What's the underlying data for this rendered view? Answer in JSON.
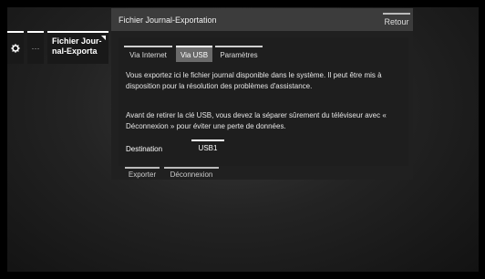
{
  "breadcrumb": {
    "gear_icon": "gear-icon",
    "more": "···",
    "current_line1": "Fichier Jour-",
    "current_line2": "nal-Exporta"
  },
  "dialog": {
    "title": "Fichier Journal-Exportation",
    "back_label": "Retour",
    "tabs": [
      {
        "label": "Via Internet",
        "selected": false
      },
      {
        "label": "Via USB",
        "selected": true
      },
      {
        "label": "Paramètres",
        "selected": false
      }
    ],
    "paragraph1": "Vous exportez ici le fichier journal disponible dans le système. Il peut être mis à disposition pour la résolution des problèmes d'assistance.",
    "paragraph2": "Avant de retirer la clé USB, vous devez la séparer sûrement du téléviseur avec « Déconnexion » pour éviter une perte de données.",
    "destination_label": "Destination",
    "destination_value": "USB1",
    "actions": {
      "export_label": "Exporter",
      "disconnect_label": "Déconnexion"
    }
  }
}
